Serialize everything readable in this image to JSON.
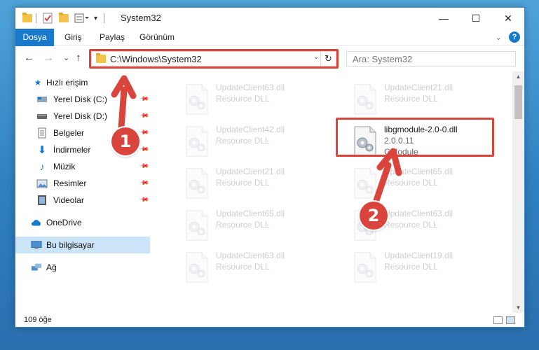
{
  "titlebar": {
    "title": "System32",
    "minimize": "—",
    "maximize": "☐",
    "close": "✕"
  },
  "ribbon": {
    "tabs": [
      "Dosya",
      "Giriş",
      "Paylaş",
      "Görünüm"
    ]
  },
  "nav": {
    "back": "←",
    "forward": "→",
    "recent": "⌄",
    "up": "↑",
    "address": "C:\\Windows\\System32",
    "refresh": "↻",
    "search_placeholder": "Ara: System32"
  },
  "sidebar": {
    "quick_access": "Hızlı erişim",
    "items": [
      {
        "label": "Yerel Disk (C:)",
        "icon": "drive-icon"
      },
      {
        "label": "Yerel Disk (D:)",
        "icon": "drive-icon"
      },
      {
        "label": "Belgeler",
        "icon": "documents-icon"
      },
      {
        "label": "İndirmeler",
        "icon": "downloads-icon"
      },
      {
        "label": "Müzik",
        "icon": "music-icon"
      },
      {
        "label": "Resimler",
        "icon": "pictures-icon"
      },
      {
        "label": "Videolar",
        "icon": "videos-icon"
      }
    ],
    "onedrive": "OneDrive",
    "this_pc": "Bu bilgisayar",
    "network": "Ağ"
  },
  "files": [
    {
      "name": "UpdateClient63.dll",
      "type": "Resource DLL"
    },
    {
      "name": "UpdateClient21.dll",
      "type": "Resource DLL"
    },
    {
      "name": "UpdateClient42.dll",
      "type": "Resource DLL"
    },
    {
      "name": "libgmodule-2.0-0.dll",
      "type": "2.0.0.11",
      "desc": "GModule"
    },
    {
      "name": "UpdateClient21.dll",
      "type": "Resource DLL"
    },
    {
      "name": "UpdateClient65.dll",
      "type": "Resource DLL"
    },
    {
      "name": "UpdateClient65.dll",
      "type": "Resource DLL"
    },
    {
      "name": "UpdateClient63.dll",
      "type": "Resource DLL"
    },
    {
      "name": "UpdateClient63.dll",
      "type": "Resource DLL"
    },
    {
      "name": "UpdateClient19.dll",
      "type": "Resource DLL"
    }
  ],
  "status": {
    "count": "109 öğe"
  },
  "annotations": {
    "step1": "1",
    "step2": "2"
  },
  "colors": {
    "accent": "#1979ca",
    "highlight": "#d9453d",
    "selected": "#cce4f7"
  }
}
